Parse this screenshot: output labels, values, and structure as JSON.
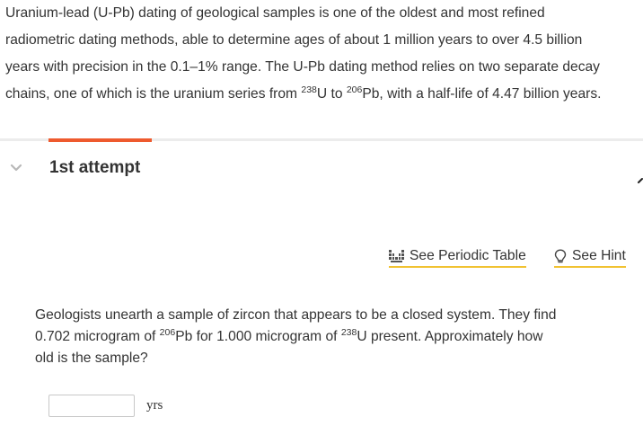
{
  "intro": {
    "line1": "Uranium-lead (U-Pb) dating of geological samples is one of the oldest and most refined",
    "line2": "radiometric dating methods, able to determine ages of about 1 million years to over 4.5 billion",
    "line3": "years with precision in the 0.1–1% range. The U-Pb dating method relies on two separate decay",
    "line4_a": "chains, one of which is the uranium series from ",
    "line4_sup1": "238",
    "line4_b": "U to ",
    "line4_sup2": "206",
    "line4_c": "Pb, with a half-life of 4.47 billion years."
  },
  "attempt": {
    "title": "1st attempt"
  },
  "tools": {
    "periodic_table": "See Periodic Table",
    "hint": "See Hint"
  },
  "question": {
    "line1": "Geologists unearth a sample of zircon that appears to be a closed system. They find",
    "line2_a": "0.702 microgram of ",
    "line2_sup1": "206",
    "line2_b": "Pb for 1.000 microgram of ",
    "line2_sup2": "238",
    "line2_c": "U present. Approximately how",
    "line3": "old is the sample?"
  },
  "answer": {
    "value": "",
    "unit": "yrs"
  },
  "colors": {
    "accent": "#ee5a2e",
    "link_underline": "#f1c232",
    "divider": "#ececec",
    "text": "#333333"
  }
}
